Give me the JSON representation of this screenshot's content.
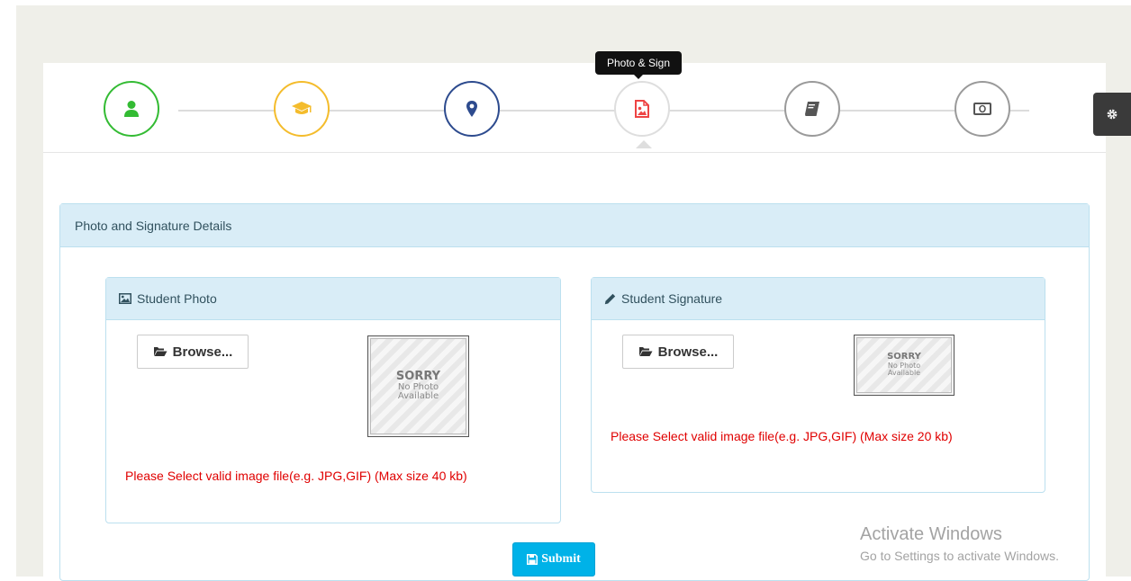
{
  "wizard": {
    "tooltip": "Photo & Sign",
    "steps": [
      {
        "icon": "user-icon",
        "color": "#33bb33"
      },
      {
        "icon": "graduation-cap-icon",
        "color": "#f4bc2c"
      },
      {
        "icon": "map-marker-icon",
        "color": "#2d4b8e"
      },
      {
        "icon": "image-file-icon",
        "color": "#ee4444",
        "active": true
      },
      {
        "icon": "book-icon",
        "color": "#555555"
      },
      {
        "icon": "money-icon",
        "color": "#555555"
      }
    ]
  },
  "settings": {
    "icon": "gear-icon"
  },
  "panel": {
    "title": "Photo and Signature Details",
    "photo": {
      "title": "Student Photo",
      "icon": "picture-icon",
      "browse_label": "Browse...",
      "browse_icon": "folder-open-icon",
      "placeholder": {
        "line1": "SORRY",
        "line2": "No Photo",
        "line3": "Available"
      },
      "hint": "Please Select valid image file(e.g. JPG,GIF) (Max size 40 kb)"
    },
    "signature": {
      "title": "Student Signature",
      "icon": "pencil-icon",
      "browse_label": "Browse...",
      "browse_icon": "folder-open-icon",
      "placeholder": {
        "line1": "SORRY",
        "line2": "No Photo",
        "line3": "Available"
      },
      "hint": "Please Select valid image file(e.g. JPG,GIF) (Max size 20 kb)"
    },
    "submit_label": "Submit",
    "submit_icon": "floppy-disk-icon"
  },
  "watermark": {
    "title": "Activate Windows",
    "subtitle": "Go to Settings to activate Windows."
  },
  "colors": {
    "accent": "#00b2e8",
    "panel_heading_bg": "#d9edf7",
    "error_text": "#e00000"
  }
}
